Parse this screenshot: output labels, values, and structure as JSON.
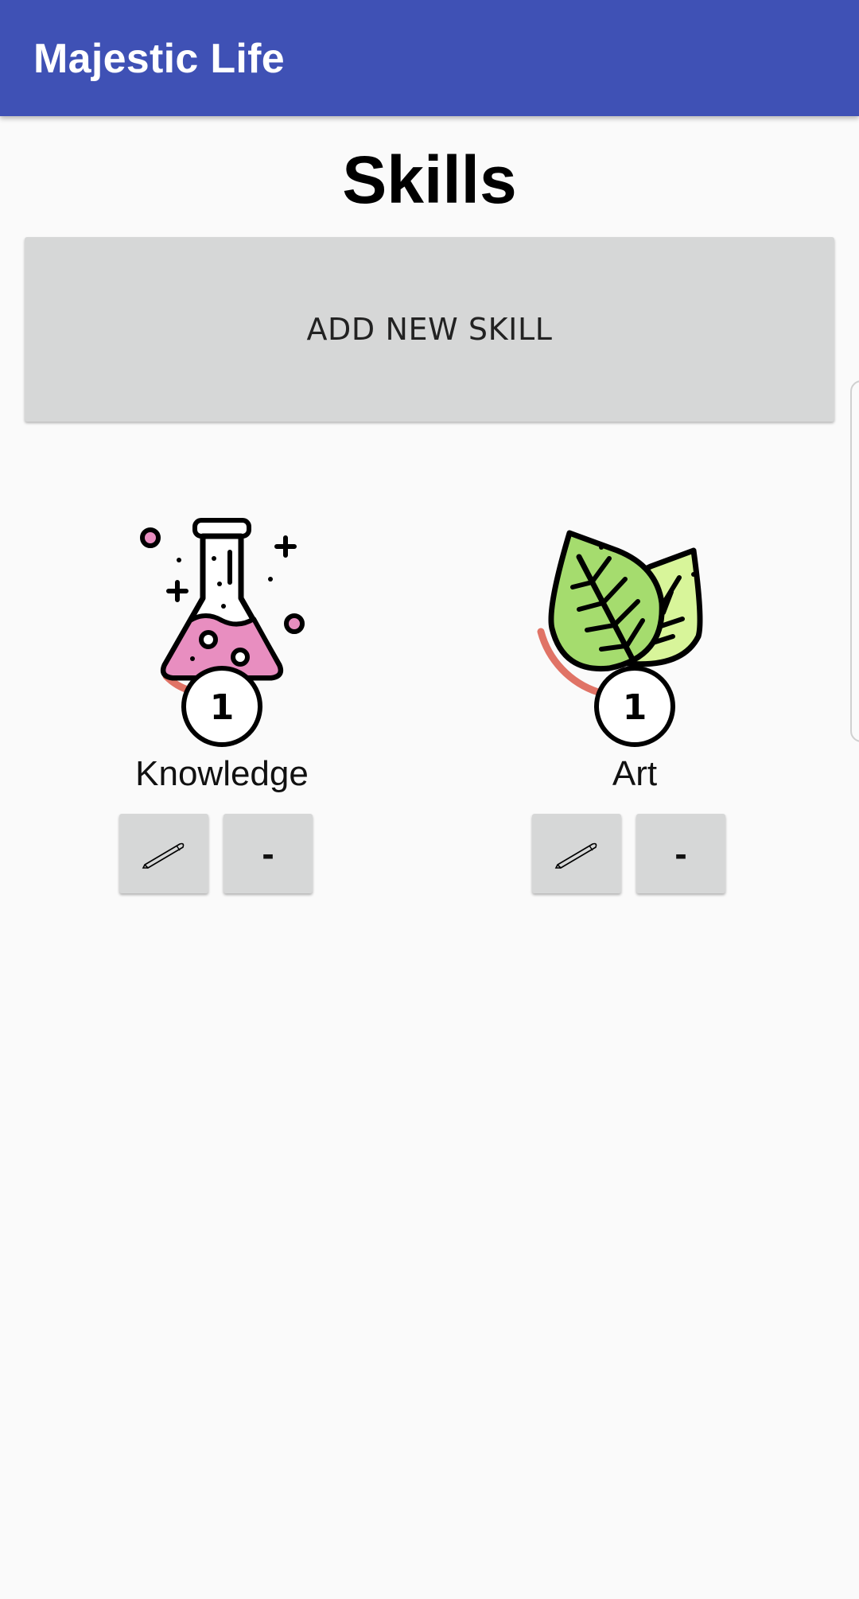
{
  "app_bar": {
    "title": "Majestic Life"
  },
  "page": {
    "title": "Skills"
  },
  "add_button": {
    "label": "ADD NEW SKILL"
  },
  "skills": [
    {
      "name": "Knowledge",
      "level": "1",
      "icon": "flask-icon",
      "icon_color": "#e88ec0",
      "progress_arc_color": "#e07366",
      "edit_icon": "pencil-icon",
      "remove_label": "-"
    },
    {
      "name": "Art",
      "level": "1",
      "icon": "leaves-icon",
      "icon_color": "#a5dc6e",
      "progress_arc_color": "#e07366",
      "edit_icon": "pencil-icon",
      "remove_label": "-"
    }
  ],
  "colors": {
    "app_bar": "#3f51b5",
    "button_bg": "#d6d7d7",
    "background": "#fafafa"
  }
}
